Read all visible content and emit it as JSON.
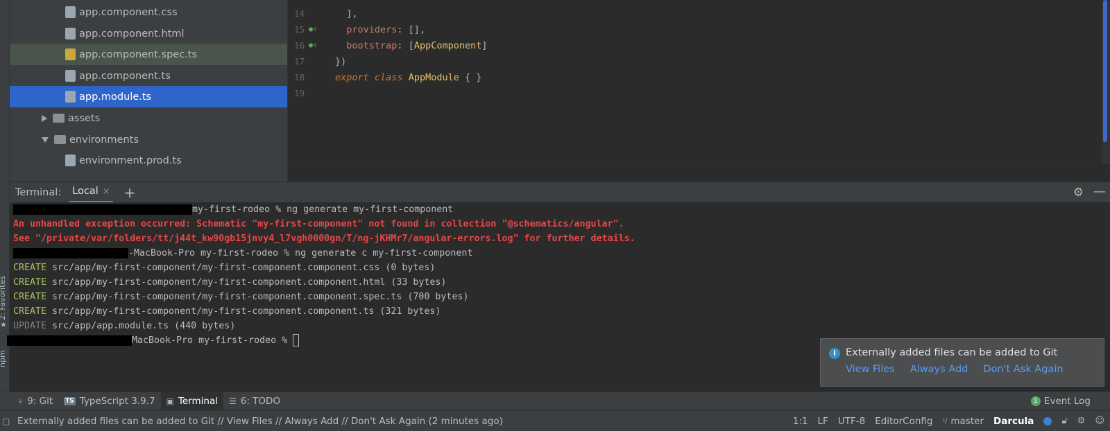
{
  "project_tree": {
    "items": [
      {
        "label": "app.component.css",
        "kind": "css",
        "indent": 80,
        "state": ""
      },
      {
        "label": "app.component.html",
        "kind": "html",
        "indent": 80,
        "state": ""
      },
      {
        "label": "app.component.spec.ts",
        "kind": "spec",
        "indent": 80,
        "state": "hl"
      },
      {
        "label": "app.component.ts",
        "kind": "ts",
        "indent": 80,
        "state": ""
      },
      {
        "label": "app.module.ts",
        "kind": "ts",
        "indent": 80,
        "state": "sel"
      },
      {
        "label": "assets",
        "kind": "folder",
        "indent": 46,
        "state": "",
        "arrow": "right"
      },
      {
        "label": "environments",
        "kind": "folder",
        "indent": 46,
        "state": "",
        "arrow": "down"
      },
      {
        "label": "environment.prod.ts",
        "kind": "ts",
        "indent": 80,
        "state": ""
      }
    ]
  },
  "editor": {
    "lines": [
      {
        "num": "14",
        "code": "  ],"
      },
      {
        "num": "15",
        "code": "  providers: [],"
      },
      {
        "num": "16",
        "code": "  bootstrap: [AppComponent]"
      },
      {
        "num": "17",
        "code": "})"
      },
      {
        "num": "18",
        "code": "export class AppModule { }"
      },
      {
        "num": "19",
        "code": ""
      }
    ]
  },
  "terminal": {
    "header_label": "Terminal:",
    "tab_label": "Local",
    "close_glyph": "×",
    "add_glyph": "+",
    "prompt_1": "my-first-rodeo % ng generate my-first-component",
    "error_1": "An unhandled exception occurred: Schematic \"my-first-component\" not found in collection \"@schematics/angular\".",
    "error_2": "See \"/private/var/folders/tt/j44t_kw90gb15jnvy4_l7vgh0000gn/T/ng-jKHMr7/angular-errors.log\" for further details.",
    "prompt_2": "-MacBook-Pro my-first-rodeo % ng generate c my-first-component",
    "create_word": "CREATE",
    "update_word": "UPDATE",
    "create_1": " src/app/my-first-component/my-first-component.component.css (0 bytes)",
    "create_2": " src/app/my-first-component/my-first-component.component.html (33 bytes)",
    "create_3": " src/app/my-first-component/my-first-component.component.spec.ts (700 bytes)",
    "create_4": " src/app/my-first-component/my-first-component.component.ts (321 bytes)",
    "update_1": " src/app/app.module.ts (440 bytes)",
    "prompt_3": "MacBook-Pro my-first-rodeo % "
  },
  "notification": {
    "message": "Externally added files can be added to Git",
    "view_files": "View Files",
    "always_add": "Always Add",
    "dont_ask": "Don't Ask Again"
  },
  "tool_windows": {
    "git": "9: Git",
    "typescript": "TypeScript 3.9.7",
    "terminal": "Terminal",
    "todo": "6: TODO",
    "event_log": "Event Log",
    "event_count": "1"
  },
  "left_strip": {
    "favorites": "2: Favorites",
    "npm": "npm"
  },
  "status_bar": {
    "message": "Externally added files can be added to Git // View Files // Always Add // Don't Ask Again (2 minutes ago)",
    "position": "1:1",
    "line_sep": "LF",
    "encoding": "UTF-8",
    "editorconfig": "EditorConfig",
    "branch": "master",
    "theme": "Darcula"
  }
}
